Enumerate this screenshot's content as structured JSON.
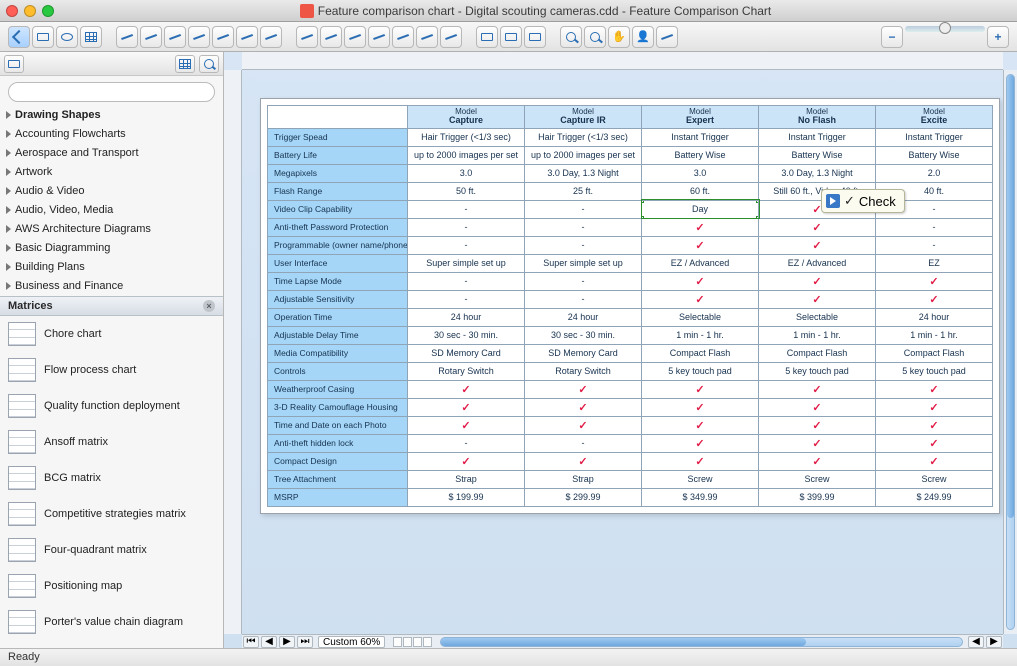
{
  "window": {
    "title": "Feature comparison chart - Digital scouting cameras.cdd - Feature Comparison Chart"
  },
  "status": {
    "text": "Ready"
  },
  "bottom": {
    "zoom_label": "Custom 60%"
  },
  "tooltip": {
    "label": "Check"
  },
  "sidebar": {
    "search_placeholder": "",
    "categories_top": [
      "Drawing Shapes",
      "Accounting Flowcharts",
      "Aerospace and Transport",
      "Artwork",
      "Audio & Video",
      "Audio, Video, Media",
      "AWS Architecture Diagrams",
      "Basic Diagramming",
      "Building Plans",
      "Business and Finance"
    ],
    "section_label": "Matrices",
    "items": [
      "Chore chart",
      "Flow process chart",
      "Quality function deployment",
      "Ansoff matrix",
      "BCG matrix",
      "Competitive strategies matrix",
      "Four-quadrant matrix",
      "Positioning map",
      "Porter's value chain diagram"
    ]
  },
  "chart_data": {
    "type": "table",
    "title": "Feature Comparison Chart",
    "column_prefix": "Model",
    "columns": [
      "Capture",
      "Capture IR",
      "Expert",
      "No Flash",
      "Excite"
    ],
    "rows": [
      {
        "label": "Trigger Spead",
        "v": [
          "Hair Trigger (<1/3 sec)",
          "Hair Trigger (<1/3 sec)",
          "Instant Trigger",
          "Instant Trigger",
          "Instant Trigger"
        ]
      },
      {
        "label": "Battery Life",
        "v": [
          "up to 2000 images per set",
          "up to 2000 images per set",
          "Battery Wise",
          "Battery Wise",
          "Battery Wise"
        ]
      },
      {
        "label": "Megapixels",
        "v": [
          "3.0",
          "3.0 Day, 1.3 Night",
          "3.0",
          "3.0 Day, 1.3 Night",
          "2.0"
        ]
      },
      {
        "label": "Flash Range",
        "v": [
          "50 ft.",
          "25 ft.",
          "60 ft.",
          "Still 60 ft., Video 40 ft.",
          "40 ft."
        ]
      },
      {
        "label": "Video Clip Capability",
        "v": [
          "-",
          "-",
          "Day",
          "CHECK",
          "-"
        ]
      },
      {
        "label": "Anti-theft Password Protection",
        "v": [
          "-",
          "-",
          "CHECK",
          "CHECK",
          "-"
        ]
      },
      {
        "label": "Programmable (owner name/phone)",
        "v": [
          "-",
          "-",
          "CHECK",
          "CHECK",
          "-"
        ]
      },
      {
        "label": "User Interface",
        "v": [
          "Super simple set up",
          "Super simple set up",
          "EZ / Advanced",
          "EZ / Advanced",
          "EZ"
        ]
      },
      {
        "label": "Time Lapse Mode",
        "v": [
          "-",
          "-",
          "CHECK",
          "CHECK",
          "CHECK"
        ]
      },
      {
        "label": "Adjustable Sensitivity",
        "v": [
          "-",
          "-",
          "CHECK",
          "CHECK",
          "CHECK"
        ]
      },
      {
        "label": "Operation Time",
        "v": [
          "24 hour",
          "24 hour",
          "Selectable",
          "Selectable",
          "24 hour"
        ]
      },
      {
        "label": "Adjustable Delay Time",
        "v": [
          "30 sec - 30 min.",
          "30 sec - 30 min.",
          "1 min - 1 hr.",
          "1 min - 1 hr.",
          "1 min - 1 hr."
        ]
      },
      {
        "label": "Media Compatibility",
        "v": [
          "SD Memory Card",
          "SD Memory Card",
          "Compact Flash",
          "Compact Flash",
          "Compact Flash"
        ]
      },
      {
        "label": "Controls",
        "v": [
          "Rotary Switch",
          "Rotary Switch",
          "5 key touch pad",
          "5 key touch pad",
          "5 key touch pad"
        ]
      },
      {
        "label": "Weatherproof Casing",
        "v": [
          "CHECK",
          "CHECK",
          "CHECK",
          "CHECK",
          "CHECK"
        ]
      },
      {
        "label": "3-D Reality Camouflage Housing",
        "v": [
          "CHECK",
          "CHECK",
          "CHECK",
          "CHECK",
          "CHECK"
        ]
      },
      {
        "label": "Time and Date on each Photo",
        "v": [
          "CHECK",
          "CHECK",
          "CHECK",
          "CHECK",
          "CHECK"
        ]
      },
      {
        "label": "Anti-theft hidden lock",
        "v": [
          "-",
          "-",
          "CHECK",
          "CHECK",
          "CHECK"
        ]
      },
      {
        "label": "Compact Design",
        "v": [
          "CHECK",
          "CHECK",
          "CHECK",
          "CHECK",
          "CHECK"
        ]
      },
      {
        "label": "Tree Attachment",
        "v": [
          "Strap",
          "Strap",
          "Screw",
          "Screw",
          "Screw"
        ]
      },
      {
        "label": "MSRP",
        "v": [
          "$ 199.99",
          "$ 299.99",
          "$ 349.99",
          "$ 399.99",
          "$ 249.99"
        ]
      }
    ],
    "selected_cell": {
      "row": 4,
      "col": 2
    }
  }
}
